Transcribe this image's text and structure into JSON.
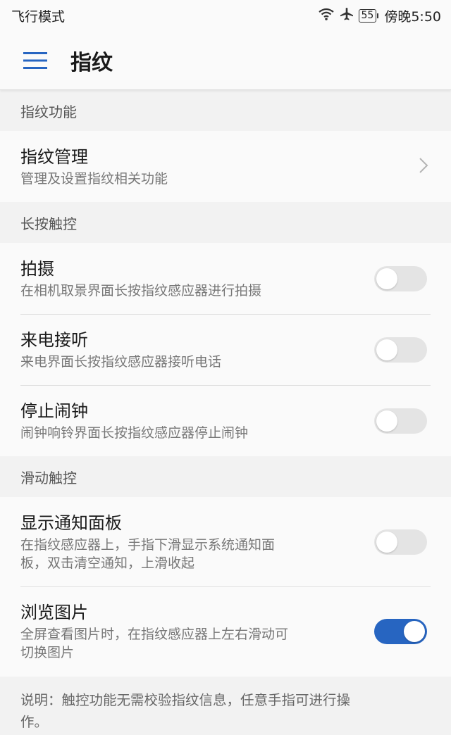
{
  "status": {
    "left": "飞行模式",
    "battery": "55",
    "time": "傍晚5:50",
    "icons": [
      "wifi-icon",
      "airplane-icon",
      "battery-icon"
    ]
  },
  "appbar": {
    "title": "指纹",
    "menu_icon": "hamburger-menu-icon"
  },
  "sections": {
    "fingerprint": {
      "header": "指纹功能",
      "manage": {
        "title": "指纹管理",
        "subtitle": "管理及设置指纹相关功能"
      }
    },
    "longpress": {
      "header": "长按触控",
      "items": [
        {
          "title": "拍摄",
          "subtitle": "在相机取景界面长按指纹感应器进行拍摄",
          "on": false
        },
        {
          "title": "来电接听",
          "subtitle": "来电界面长按指纹感应器接听电话",
          "on": false
        },
        {
          "title": "停止闹钟",
          "subtitle": "闹钟响铃界面长按指纹感应器停止闹钟",
          "on": false
        }
      ]
    },
    "swipe": {
      "header": "滑动触控",
      "items": [
        {
          "title": "显示通知面板",
          "subtitle_line1": "在指纹感应器上，手指下滑显示系统通知面",
          "subtitle_line2": "板，双击清空通知，上滑收起",
          "on": false
        },
        {
          "title": "浏览图片",
          "subtitle_line1": "全屏查看图片时，在指纹感应器上左右滑动可",
          "subtitle_line2": "切换图片",
          "on": true
        }
      ]
    }
  },
  "note": {
    "line1": "说明：触控功能无需校验指纹信息，任意手指可进行操",
    "line2": "作。"
  },
  "colors": {
    "accent": "#2765c1",
    "toggle_off": "#e4e4e4",
    "background": "#f2f2f2"
  }
}
